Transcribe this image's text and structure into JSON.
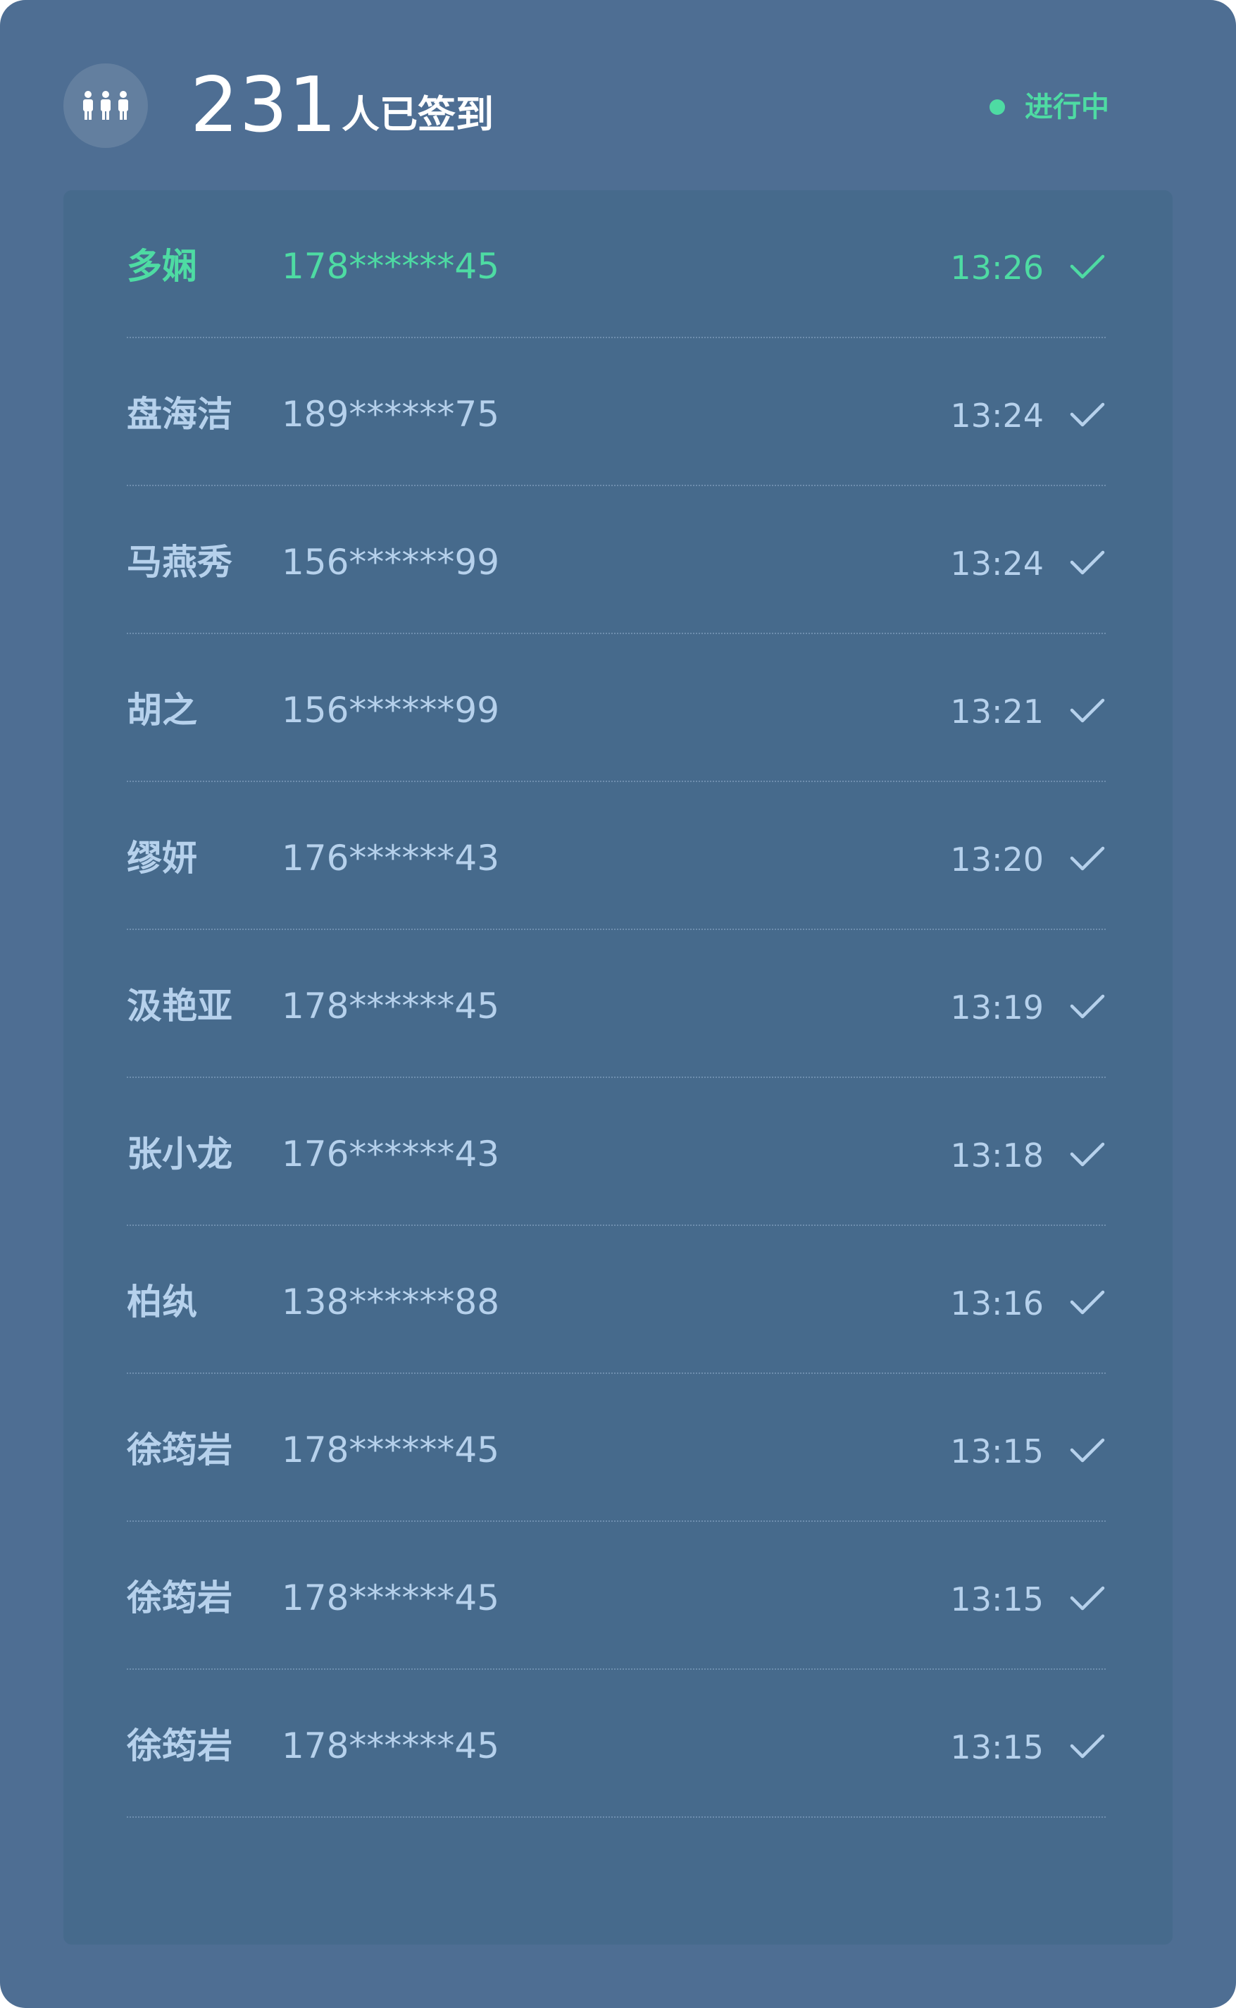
{
  "header": {
    "count": "231",
    "count_label": "人已签到",
    "status": "进行中",
    "icon": "people-group-icon"
  },
  "colors": {
    "background": "#4e6e93",
    "panel": "#466a8c",
    "accent": "#4edba3",
    "text": "#b6d1ec"
  },
  "list": {
    "rows": [
      {
        "name": "多娴",
        "phone": "178******45",
        "time": "13:26",
        "active": true
      },
      {
        "name": "盘海洁",
        "phone": "189******75",
        "time": "13:24",
        "active": false
      },
      {
        "name": "马燕秀",
        "phone": "156******99",
        "time": "13:24",
        "active": false
      },
      {
        "name": "胡之",
        "phone": "156******99",
        "time": "13:21",
        "active": false
      },
      {
        "name": "缪妍",
        "phone": "176******43",
        "time": "13:20",
        "active": false
      },
      {
        "name": "汲艳亚",
        "phone": "178******45",
        "time": "13:19",
        "active": false
      },
      {
        "name": "张小龙",
        "phone": "176******43",
        "time": "13:18",
        "active": false
      },
      {
        "name": "柏纨",
        "phone": "138******88",
        "time": "13:16",
        "active": false
      },
      {
        "name": "徐筠岩",
        "phone": "178******45",
        "time": "13:15",
        "active": false
      },
      {
        "name": "徐筠岩",
        "phone": "178******45",
        "time": "13:15",
        "active": false
      },
      {
        "name": "徐筠岩",
        "phone": "178******45",
        "time": "13:15",
        "active": false
      }
    ]
  }
}
